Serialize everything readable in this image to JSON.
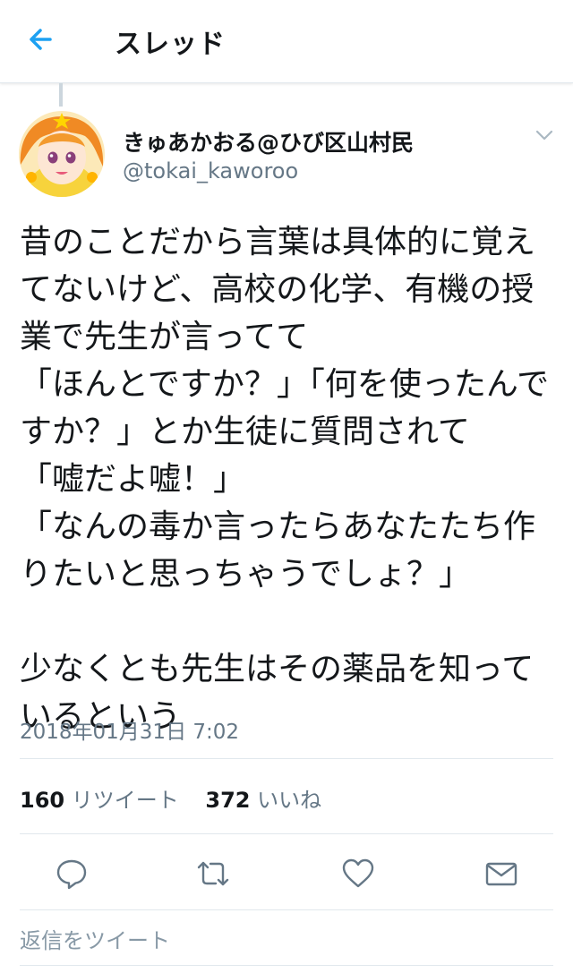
{
  "header": {
    "title": "スレッド",
    "back_icon": "arrow-left-icon"
  },
  "colors": {
    "accent": "#1da1f2",
    "secondary_text": "#657786",
    "divider": "#e1e8ed",
    "icon_gray": "#657786"
  },
  "tweet": {
    "display_name": "きゅあかおる@ひび区山村民",
    "handle": "@tokai_kaworoo",
    "text": "昔のことだから言葉は具体的に覚えてないけど、高校の化学、有機の授業で先生が言ってて\n「ほんとですか？」「何を使ったんですか？」とか生徒に質問されて\n「嘘だよ嘘！」\n「なんの毒か言ったらあなたたち作りたいと思っちゃうでしょ？」\n\n少なくとも先生はその薬品を知っているという",
    "timestamp": "2018年01月31日 7:02",
    "retweet_count": "160",
    "retweet_label": "リツイート",
    "like_count": "372",
    "like_label": "いいね"
  },
  "actions": [
    "reply-icon",
    "retweet-icon",
    "heart-icon",
    "envelope-icon"
  ],
  "reply_box": {
    "placeholder": "返信をツイート"
  }
}
